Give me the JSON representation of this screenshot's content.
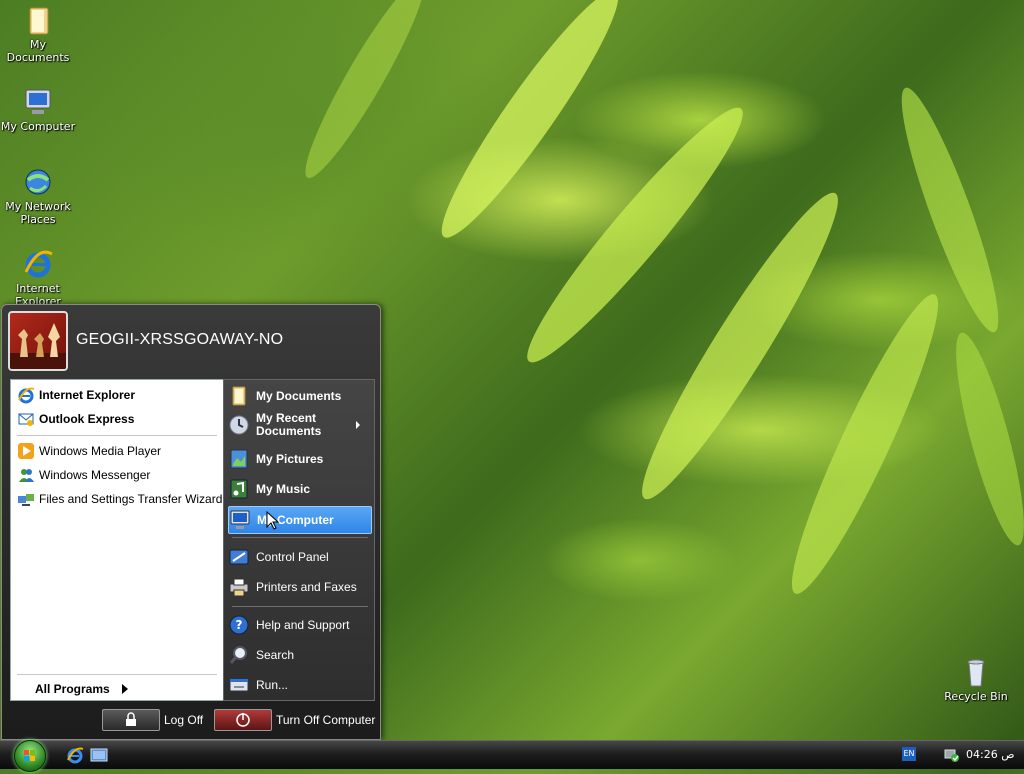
{
  "desktop": {
    "icons": [
      {
        "label": "My Documents"
      },
      {
        "label": "My Computer"
      },
      {
        "label": "My Network Places"
      },
      {
        "label": "Internet Explorer"
      },
      {
        "label": "Recycle Bin"
      }
    ]
  },
  "start_menu": {
    "user_name": "GEOGII-XRSSGOAWAY-NO",
    "left_pinned": [
      "Internet Explorer",
      "Outlook Express"
    ],
    "left_recent": [
      "Windows Media Player",
      "Windows Messenger",
      "Files and Settings Transfer Wizard"
    ],
    "all_programs": "All Programs",
    "right_items": [
      {
        "label": "My Documents"
      },
      {
        "label": "My Recent Documents"
      },
      {
        "label": "My Pictures"
      },
      {
        "label": "My Music"
      },
      {
        "label": "My Computer"
      },
      {
        "label": "Control Panel"
      },
      {
        "label": "Printers and Faxes"
      },
      {
        "label": "Help and Support"
      },
      {
        "label": "Search"
      },
      {
        "label": "Run..."
      }
    ],
    "highlighted_item": "My Computer",
    "log_off": "Log Off",
    "turn_off": "Turn Off Computer"
  },
  "taskbar": {
    "language": "EN",
    "clock": "04:26 ص"
  },
  "colors": {
    "highlight": "#3d8ff0",
    "menu_dark": "#2a2a2a"
  }
}
